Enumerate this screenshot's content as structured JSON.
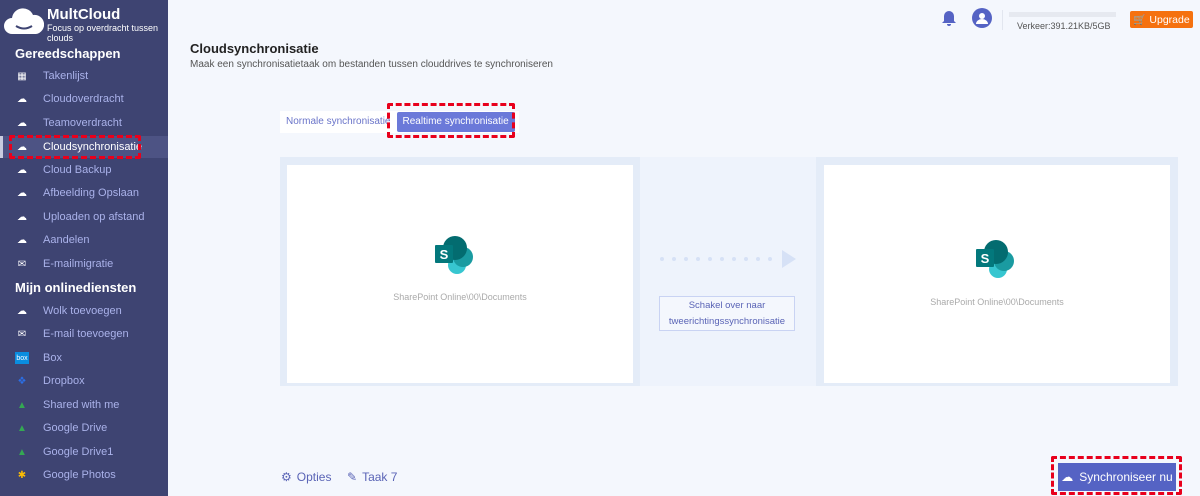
{
  "app": {
    "brand": "MultCloud",
    "tagline": "Focus op overdracht tussen clouds"
  },
  "sidebar": {
    "tools_header": "Gereedschappen",
    "tools": [
      {
        "label": "Takenlijst",
        "icon": "grid-icon"
      },
      {
        "label": "Cloudoverdracht",
        "icon": "cloud-transfer-icon"
      },
      {
        "label": "Teamoverdracht",
        "icon": "team-cloud-icon"
      },
      {
        "label": "Cloudsynchronisatie",
        "icon": "cloud-sync-icon",
        "active": true
      },
      {
        "label": "Cloud Backup",
        "icon": "cloud-backup-icon"
      },
      {
        "label": "Afbeelding Opslaan",
        "icon": "image-save-icon"
      },
      {
        "label": "Uploaden op afstand",
        "icon": "remote-upload-icon"
      },
      {
        "label": "Aandelen",
        "icon": "share-icon"
      },
      {
        "label": "E-mailmigratie",
        "icon": "email-migration-icon"
      }
    ],
    "services_header": "Mijn onlinediensten",
    "services": [
      {
        "label": "Wolk toevoegen",
        "icon": "add-cloud-icon"
      },
      {
        "label": "E-mail toevoegen",
        "icon": "add-email-icon"
      },
      {
        "label": "Box",
        "icon": "box-icon"
      },
      {
        "label": "Dropbox",
        "icon": "dropbox-icon"
      },
      {
        "label": "Shared with me",
        "icon": "google-drive-icon"
      },
      {
        "label": "Google Drive",
        "icon": "google-drive-icon"
      },
      {
        "label": "Google Drive1",
        "icon": "google-drive-icon"
      },
      {
        "label": "Google Photos",
        "icon": "google-photos-icon"
      }
    ]
  },
  "topbar": {
    "traffic": "Verkeer:391.21KB/5GB",
    "upgrade": "Upgrade"
  },
  "main": {
    "title": "Cloudsynchronisatie",
    "subtitle": "Maak een synchronisatietaak om bestanden tussen clouddrives te synchroniseren",
    "tabs": [
      "Normale synchronisatie",
      "Realtime synchronisatie"
    ],
    "source_path": "SharePoint Online\\00\\Documents",
    "target_path": "SharePoint Online\\00\\Documents",
    "switch_button": "Schakel over naar tweerichtingssynchronisatie",
    "options": "Opties",
    "task": "Taak 7",
    "sync_now": "Synchroniseer nu"
  },
  "colors": {
    "sidebar": "#3e4472",
    "accent": "#5563c4",
    "upgrade": "#f5710f",
    "highlight": "#e8001c"
  }
}
